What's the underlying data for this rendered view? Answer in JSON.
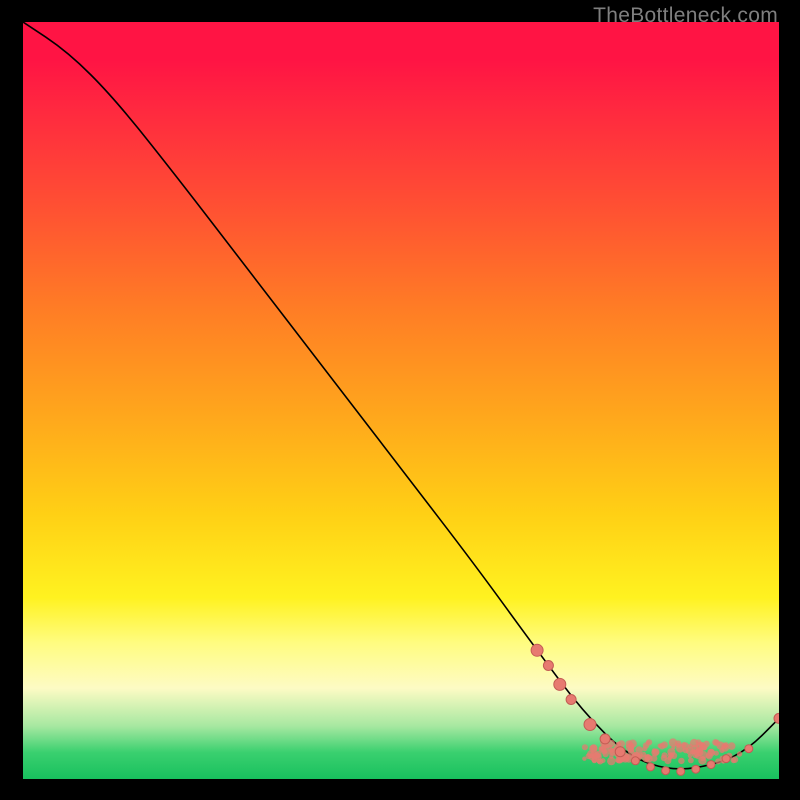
{
  "watermark": "TheBottleneck.com",
  "colors": {
    "marker": "#e77a70",
    "marker_stroke": "#c35c54",
    "curve": "#000000"
  },
  "chart_data": {
    "type": "line",
    "title": "",
    "xlabel": "",
    "ylabel": "",
    "xlim": [
      0,
      100
    ],
    "ylim": [
      0,
      100
    ],
    "grid": false,
    "legend": false,
    "curve_points": [
      {
        "x": 0,
        "y": 100
      },
      {
        "x": 6,
        "y": 96
      },
      {
        "x": 12,
        "y": 90
      },
      {
        "x": 20,
        "y": 80
      },
      {
        "x": 30,
        "y": 67
      },
      {
        "x": 40,
        "y": 54
      },
      {
        "x": 50,
        "y": 41
      },
      {
        "x": 60,
        "y": 28
      },
      {
        "x": 68,
        "y": 17
      },
      {
        "x": 74,
        "y": 9
      },
      {
        "x": 80,
        "y": 3
      },
      {
        "x": 86,
        "y": 1
      },
      {
        "x": 92,
        "y": 2
      },
      {
        "x": 96,
        "y": 4
      },
      {
        "x": 100,
        "y": 8
      }
    ],
    "marker_points": [
      {
        "x": 68,
        "y": 17,
        "r": 6
      },
      {
        "x": 69.5,
        "y": 15,
        "r": 5
      },
      {
        "x": 71,
        "y": 12.5,
        "r": 6
      },
      {
        "x": 72.5,
        "y": 10.5,
        "r": 5
      },
      {
        "x": 75,
        "y": 7.2,
        "r": 6
      },
      {
        "x": 77,
        "y": 5.3,
        "r": 5
      },
      {
        "x": 79,
        "y": 3.6,
        "r": 5
      },
      {
        "x": 81,
        "y": 2.4,
        "r": 4
      },
      {
        "x": 83,
        "y": 1.6,
        "r": 4
      },
      {
        "x": 85,
        "y": 1.1,
        "r": 4
      },
      {
        "x": 87,
        "y": 1.0,
        "r": 4
      },
      {
        "x": 89,
        "y": 1.3,
        "r": 4
      },
      {
        "x": 91,
        "y": 1.9,
        "r": 4
      },
      {
        "x": 93,
        "y": 2.7,
        "r": 4
      },
      {
        "x": 96,
        "y": 4.0,
        "r": 4
      },
      {
        "x": 100,
        "y": 8.0,
        "r": 5
      }
    ],
    "marker_cluster_center": {
      "x": 83,
      "y": 2.8
    },
    "gradient_stops": [
      {
        "pos": 0,
        "color": "#ff1444"
      },
      {
        "pos": 0.25,
        "color": "#ff5232"
      },
      {
        "pos": 0.52,
        "color": "#ffa71c"
      },
      {
        "pos": 0.76,
        "color": "#fff220"
      },
      {
        "pos": 0.93,
        "color": "#a7e8a1"
      },
      {
        "pos": 1.0,
        "color": "#18c05e"
      }
    ]
  }
}
